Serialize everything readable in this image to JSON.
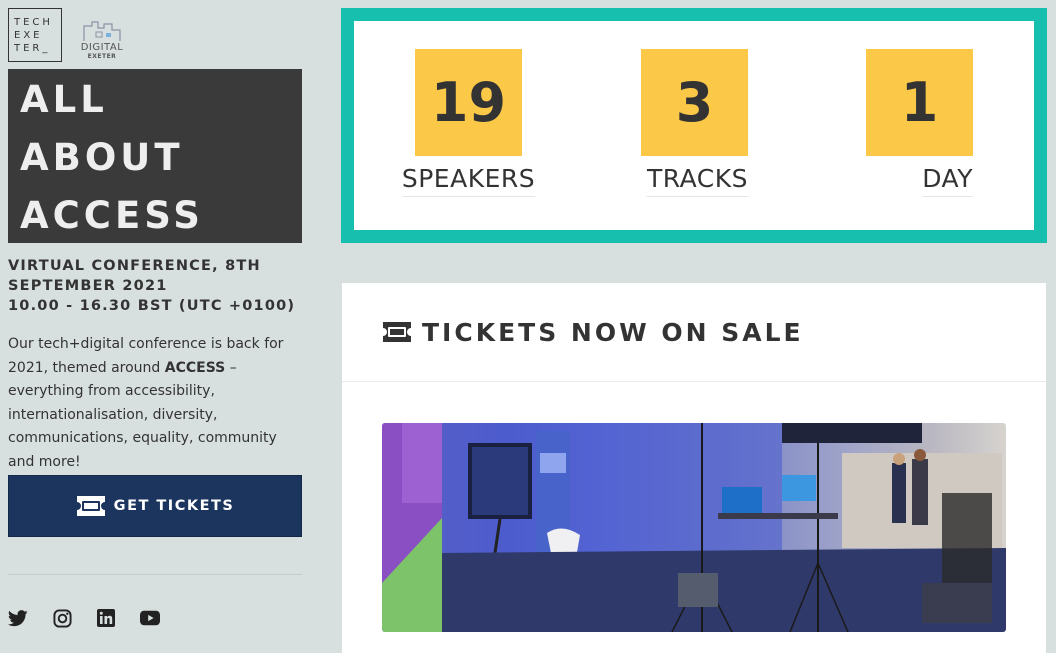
{
  "logos": {
    "tech_exeter_lines": [
      "TECH",
      "EXE",
      "TER_"
    ],
    "digital_exeter_line1": "DIGITAL",
    "digital_exeter_line2": "EXETER"
  },
  "hero": {
    "lines": [
      "ALL",
      "ABOUT",
      "ACCESS"
    ]
  },
  "conference": {
    "line1": "VIRTUAL CONFERENCE, 8TH",
    "line2": "SEPTEMBER 2021",
    "line3": "10.00 - 16.30 BST (UTC +0100)"
  },
  "blurb": {
    "before": "Our tech+digital conference is back for 2021, themed around ",
    "bold": "ACCESS",
    "after": " – everything from accessibility, internationalisation, diversity, communications, equality, community and more!"
  },
  "cta": {
    "label": "GET TICKETS",
    "icon": "ticket-icon"
  },
  "social": [
    "twitter-icon",
    "instagram-icon",
    "linkedin-icon",
    "youtube-icon"
  ],
  "stats": [
    {
      "value": "19",
      "label": "SPEAKERS"
    },
    {
      "value": "3",
      "label": "TRACKS"
    },
    {
      "value": "1",
      "label": "DAY"
    }
  ],
  "tickets": {
    "title": "TICKETS NOW ON SALE",
    "icon": "ticket-icon"
  },
  "colors": {
    "background": "#d8dfdf",
    "hero_bg": "#3a3a3a",
    "button_bg": "#1b355e",
    "stats_border": "#17bfae",
    "stat_tile": "#fbc848"
  }
}
